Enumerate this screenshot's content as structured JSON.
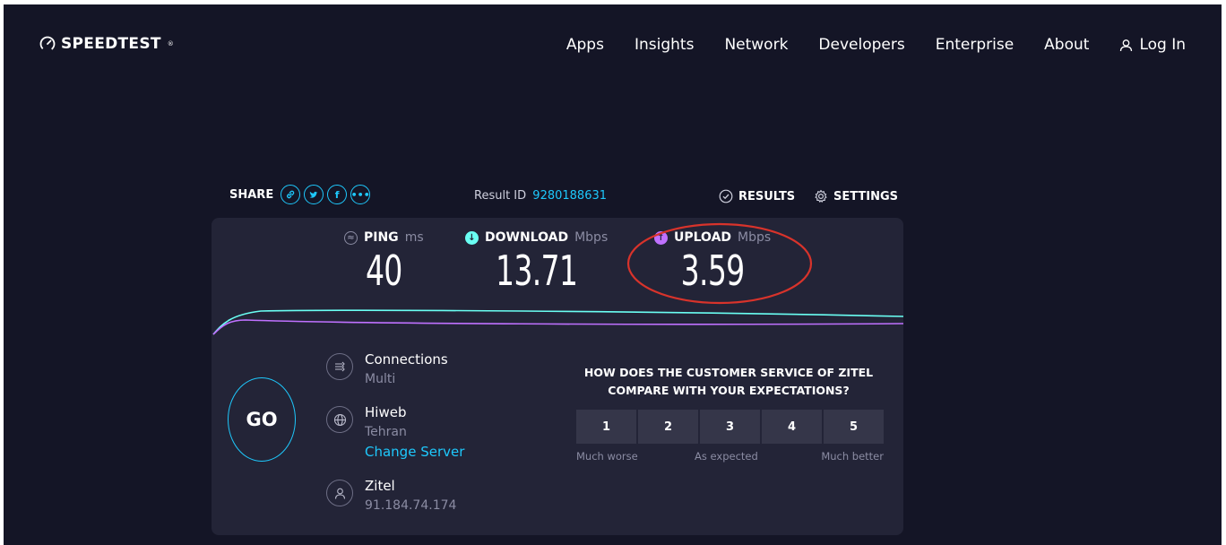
{
  "header": {
    "logo_text": "SPEEDTEST",
    "logo_mark": "®",
    "nav": [
      "Apps",
      "Insights",
      "Network",
      "Developers",
      "Enterprise",
      "About"
    ],
    "login_label": "Log In"
  },
  "share": {
    "label": "SHARE",
    "icons": [
      "link-icon",
      "twitter-icon",
      "facebook-icon",
      "more-icon"
    ]
  },
  "result": {
    "label": "Result ID",
    "id": "9280188631",
    "results_label": "RESULTS",
    "settings_label": "SETTINGS"
  },
  "metrics": {
    "ping": {
      "label": "PING",
      "unit": "ms",
      "value": "40"
    },
    "download": {
      "label": "DOWNLOAD",
      "unit": "Mbps",
      "value": "13.71"
    },
    "upload": {
      "label": "UPLOAD",
      "unit": "Mbps",
      "value": "3.59"
    }
  },
  "go_label": "GO",
  "connections": {
    "title": "Connections",
    "value": "Multi"
  },
  "server": {
    "name": "Hiweb",
    "location": "Tehran",
    "change_label": "Change Server"
  },
  "provider": {
    "name": "Zitel",
    "ip": "91.184.74.174"
  },
  "survey": {
    "question": "HOW DOES THE CUSTOMER SERVICE OF ZITEL COMPARE WITH YOUR EXPECTATIONS?",
    "options": [
      "1",
      "2",
      "3",
      "4",
      "5"
    ],
    "label_low": "Much worse",
    "label_mid": "As expected",
    "label_high": "Much better"
  },
  "colors": {
    "background": "#141526",
    "card": "#232437",
    "accent": "#1ec8fc",
    "download": "#6afff3",
    "upload": "#bf71ff",
    "highlight": "#d8332b"
  }
}
